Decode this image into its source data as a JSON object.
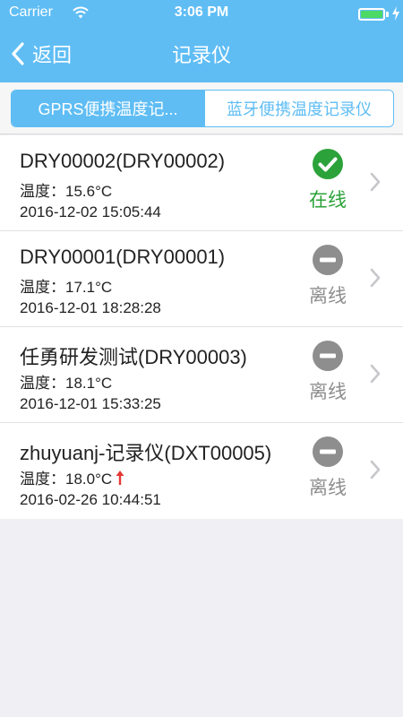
{
  "status_bar": {
    "carrier": "Carrier",
    "time": "3:06 PM",
    "battery_color": "#4cd964"
  },
  "navbar": {
    "back_label": "返回",
    "title": "记录仪",
    "background": "#5fbdf4"
  },
  "segments": {
    "active_label": "GPRS便携温度记...",
    "inactive_label": "蓝牙便携温度记录仪"
  },
  "devices": [
    {
      "name": "DRY00002(DRY00002)",
      "temp": "温度：15.6°C",
      "date": "2016-12-02 15:05:44",
      "status": "在线",
      "status_type": "online",
      "rising": false
    },
    {
      "name": "DRY00001(DRY00001)",
      "temp": "温度：17.1°C",
      "date": "2016-12-01 18:28:28",
      "status": "离线",
      "status_type": "offline",
      "rising": false
    },
    {
      "name": "任勇研发测试(DRY00003)",
      "temp": "温度：18.1°C",
      "date": "2016-12-01 15:33:25",
      "status": "离线",
      "status_type": "offline",
      "rising": false
    },
    {
      "name": "zhuyuanj-记录仪(DXT00005)",
      "temp": "温度：18.0°C",
      "date": "2016-02-26 10:44:51",
      "status": "离线",
      "status_type": "offline",
      "rising": true
    }
  ],
  "colors": {
    "online": "#2ca23a",
    "offline": "#8e8e8e",
    "rising_arrow": "#e53935"
  }
}
